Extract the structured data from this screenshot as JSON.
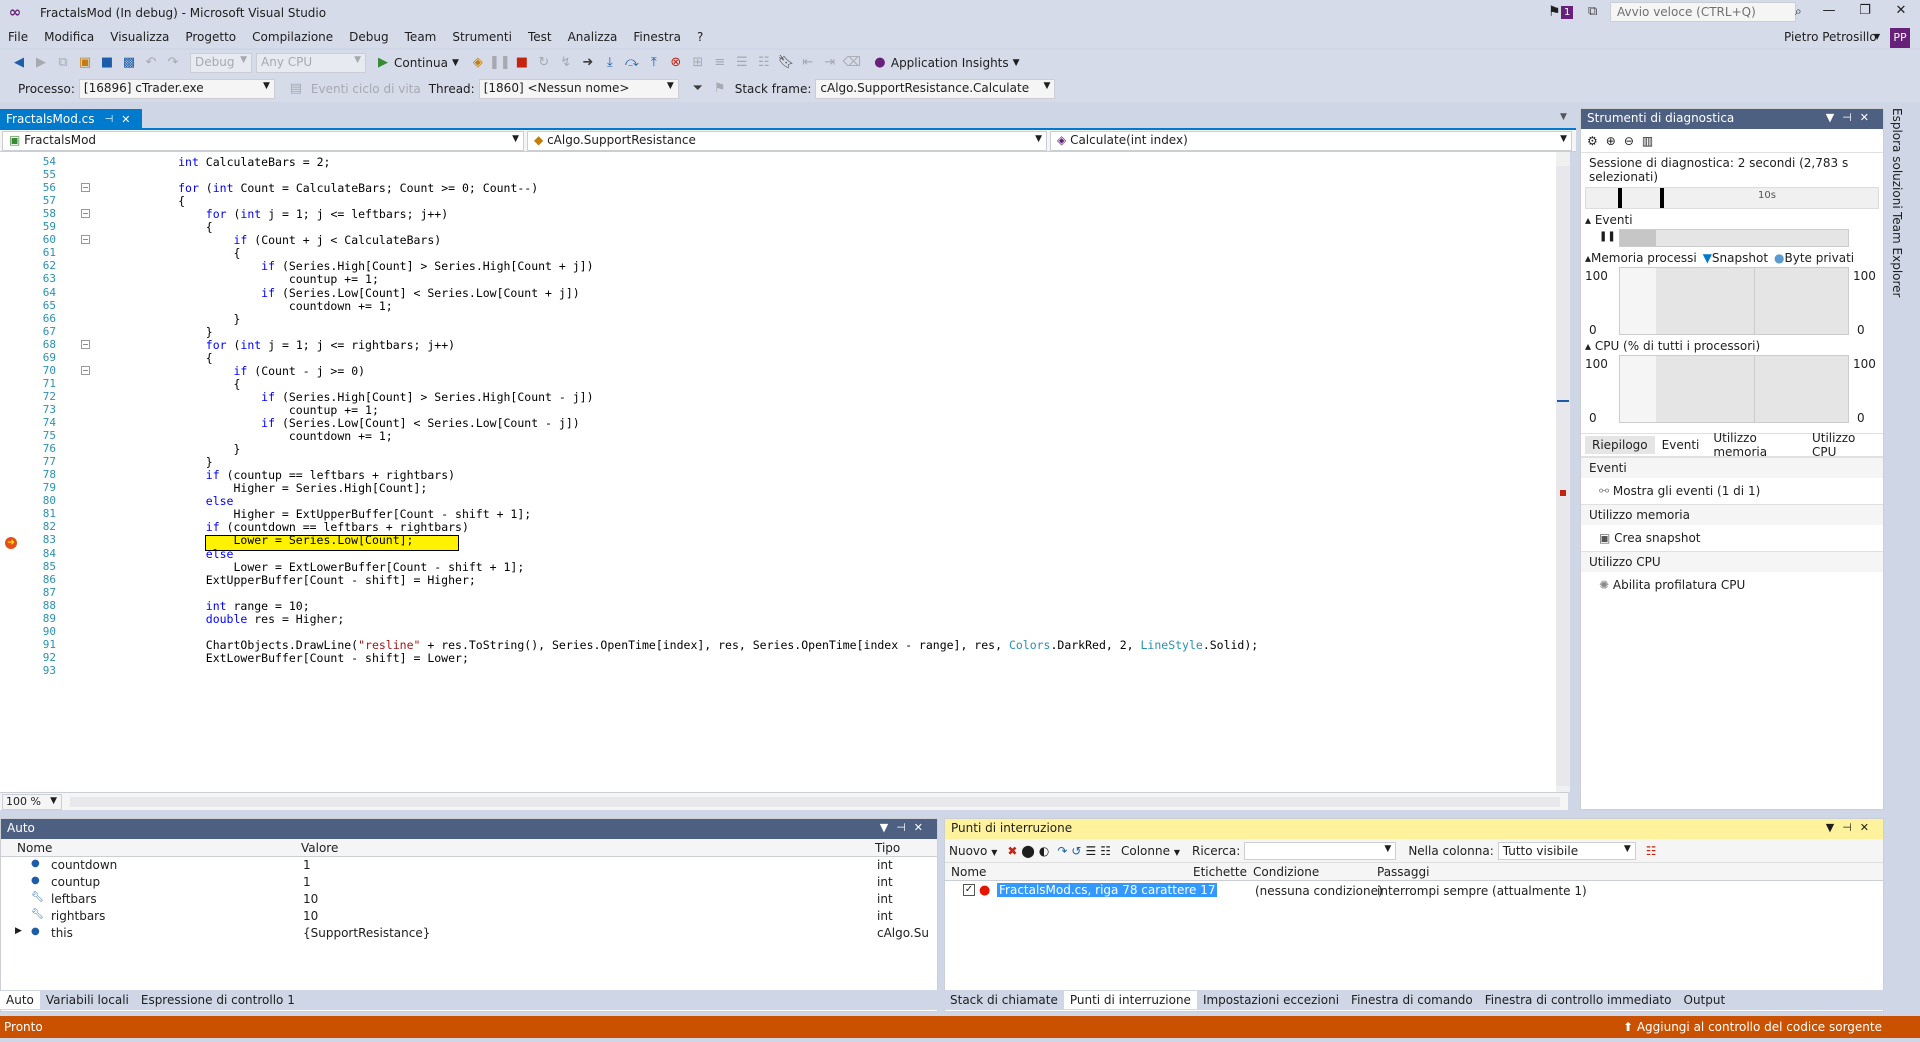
{
  "window": {
    "title": "FractalsMod (In debug) - Microsoft Visual Studio",
    "notif_count": "1",
    "quicklaunch_placeholder": "Avvio veloce (CTRL+Q)"
  },
  "menu": [
    "File",
    "Modifica",
    "Visualizza",
    "Progetto",
    "Compilazione",
    "Debug",
    "Team",
    "Strumenti",
    "Test",
    "Analizza",
    "Finestra",
    "?"
  ],
  "user": {
    "name": "Pietro Petrosillo",
    "initials": "PP"
  },
  "toolbar1": {
    "config": "Debug",
    "platform": "Any CPU",
    "continue": "Continua",
    "app_insights": "Application Insights"
  },
  "toolbar2": {
    "process_label": "Processo:",
    "process_value": "[16896] cTrader.exe",
    "lifecycle": "Eventi ciclo di vita",
    "thread_label": "Thread:",
    "thread_value": "[1860] <Nessun nome>",
    "stack_label": "Stack frame:",
    "stack_value": "cAlgo.SupportResistance.Calculate"
  },
  "doc": {
    "tab": "FractalsMod.cs",
    "nav_project": "FractalsMod",
    "nav_class": "cAlgo.SupportResistance",
    "nav_member": "Calculate(int index)",
    "zoom": "100 %"
  },
  "code_lines": [
    {
      "n": "54",
      "t": "            int CalculateBars = 2;"
    },
    {
      "n": "55",
      "t": ""
    },
    {
      "n": "56",
      "t": "            for (int Count = CalculateBars; Count >= 0; Count--)"
    },
    {
      "n": "57",
      "t": "            {"
    },
    {
      "n": "58",
      "t": "                for (int j = 1; j <= leftbars; j++)"
    },
    {
      "n": "59",
      "t": "                {"
    },
    {
      "n": "60",
      "t": "                    if (Count + j < CalculateBars)"
    },
    {
      "n": "61",
      "t": "                    {"
    },
    {
      "n": "62",
      "t": "                        if (Series.High[Count] > Series.High[Count + j])"
    },
    {
      "n": "63",
      "t": "                            countup += 1;"
    },
    {
      "n": "64",
      "t": "                        if (Series.Low[Count] < Series.Low[Count + j])"
    },
    {
      "n": "65",
      "t": "                            countdown += 1;"
    },
    {
      "n": "66",
      "t": "                    }"
    },
    {
      "n": "67",
      "t": "                }"
    },
    {
      "n": "68",
      "t": "                for (int j = 1; j <= rightbars; j++)"
    },
    {
      "n": "69",
      "t": "                {"
    },
    {
      "n": "70",
      "t": "                    if (Count - j >= 0)"
    },
    {
      "n": "71",
      "t": "                    {"
    },
    {
      "n": "72",
      "t": "                        if (Series.High[Count] > Series.High[Count - j])"
    },
    {
      "n": "73",
      "t": "                            countup += 1;"
    },
    {
      "n": "74",
      "t": "                        if (Series.Low[Count] < Series.Low[Count - j])"
    },
    {
      "n": "75",
      "t": "                            countdown += 1;"
    },
    {
      "n": "76",
      "t": "                    }"
    },
    {
      "n": "77",
      "t": "                }"
    },
    {
      "n": "78",
      "t": "                if (countup == leftbars + rightbars)"
    },
    {
      "n": "79",
      "t": "                    Higher = Series.High[Count];"
    },
    {
      "n": "80",
      "t": "                else"
    },
    {
      "n": "81",
      "t": "                    Higher = ExtUpperBuffer[Count - shift + 1];"
    },
    {
      "n": "82",
      "t": "                if (countdown == leftbars + rightbars)"
    },
    {
      "n": "83",
      "t": "                    Lower = Series.Low[Count];"
    },
    {
      "n": "84",
      "t": "                else"
    },
    {
      "n": "85",
      "t": "                    Lower = ExtLowerBuffer[Count - shift + 1];"
    },
    {
      "n": "86",
      "t": "                ExtUpperBuffer[Count - shift] = Higher;"
    },
    {
      "n": "87",
      "t": ""
    },
    {
      "n": "88",
      "t": "                int range = 10;"
    },
    {
      "n": "89",
      "t": "                double res = Higher;"
    },
    {
      "n": "90",
      "t": ""
    },
    {
      "n": "91",
      "t": "                ChartObjects.DrawLine(\"resline\" + res.ToString(), Series.OpenTime[index], res, Series.OpenTime[index - range], res, Colors.DarkRed, 2, LineStyle.Solid);"
    },
    {
      "n": "92",
      "t": "                ExtLowerBuffer[Count - shift] = Lower;"
    },
    {
      "n": "93",
      "t": ""
    }
  ],
  "diag": {
    "title": "Strumenti di diagnostica",
    "session": "Sessione di diagnostica: 2 secondi (2,783 s selezionati)",
    "tick_10s": "10s",
    "events": "Eventi",
    "memory": "Memoria processi",
    "snapshot": "Snapshot",
    "private_bytes": "Byte privati",
    "mem_max": "100",
    "mem_min": "0",
    "cpu": "CPU (% di tutti i processori)",
    "cpu_max": "100",
    "cpu_min": "0",
    "tabs": [
      "Riepilogo",
      "Eventi",
      "Utilizzo memoria",
      "Utilizzo CPU"
    ],
    "sec_events": "Eventi",
    "show_events": "Mostra gli eventi (1 di 1)",
    "sec_memory": "Utilizzo memoria",
    "create_snapshot": "Crea snapshot",
    "sec_cpu": "Utilizzo CPU",
    "enable_cpu": "Abilita profilatura CPU"
  },
  "sidetabs": [
    "Esplora soluzioni",
    "Team Explorer"
  ],
  "auto": {
    "title": "Auto",
    "cols": [
      "Nome",
      "Valore",
      "Tipo"
    ],
    "rows": [
      {
        "name": "countdown",
        "value": "1",
        "type": "int"
      },
      {
        "name": "countup",
        "value": "1",
        "type": "int"
      },
      {
        "name": "leftbars",
        "value": "10",
        "type": "int"
      },
      {
        "name": "rightbars",
        "value": "10",
        "type": "int"
      },
      {
        "name": "this",
        "value": "{SupportResistance}",
        "type": "cAlgo.Su"
      }
    ],
    "tabs": [
      "Auto",
      "Variabili locali",
      "Espressione di controllo 1"
    ]
  },
  "bp": {
    "title": "Punti di interruzione",
    "new": "Nuovo",
    "columns": "Colonne",
    "search_label": "Ricerca:",
    "in_column_label": "Nella colonna:",
    "in_column_value": "Tutto visibile",
    "cols": [
      "Nome",
      "Etichette",
      "Condizione",
      "Passaggi"
    ],
    "row": {
      "name": "FractalsMod.cs, riga 78 carattere 17",
      "labels": "",
      "condition": "(nessuna condizione)",
      "hits": "interrompi sempre (attualmente 1)"
    },
    "tabs": [
      "Stack di chiamate",
      "Punti di interruzione",
      "Impostazioni eccezioni",
      "Finestra di comando",
      "Finestra di controllo immediato",
      "Output"
    ]
  },
  "status": {
    "text": "Pronto",
    "scc": "Aggiungi al controllo del codice sorgente"
  }
}
